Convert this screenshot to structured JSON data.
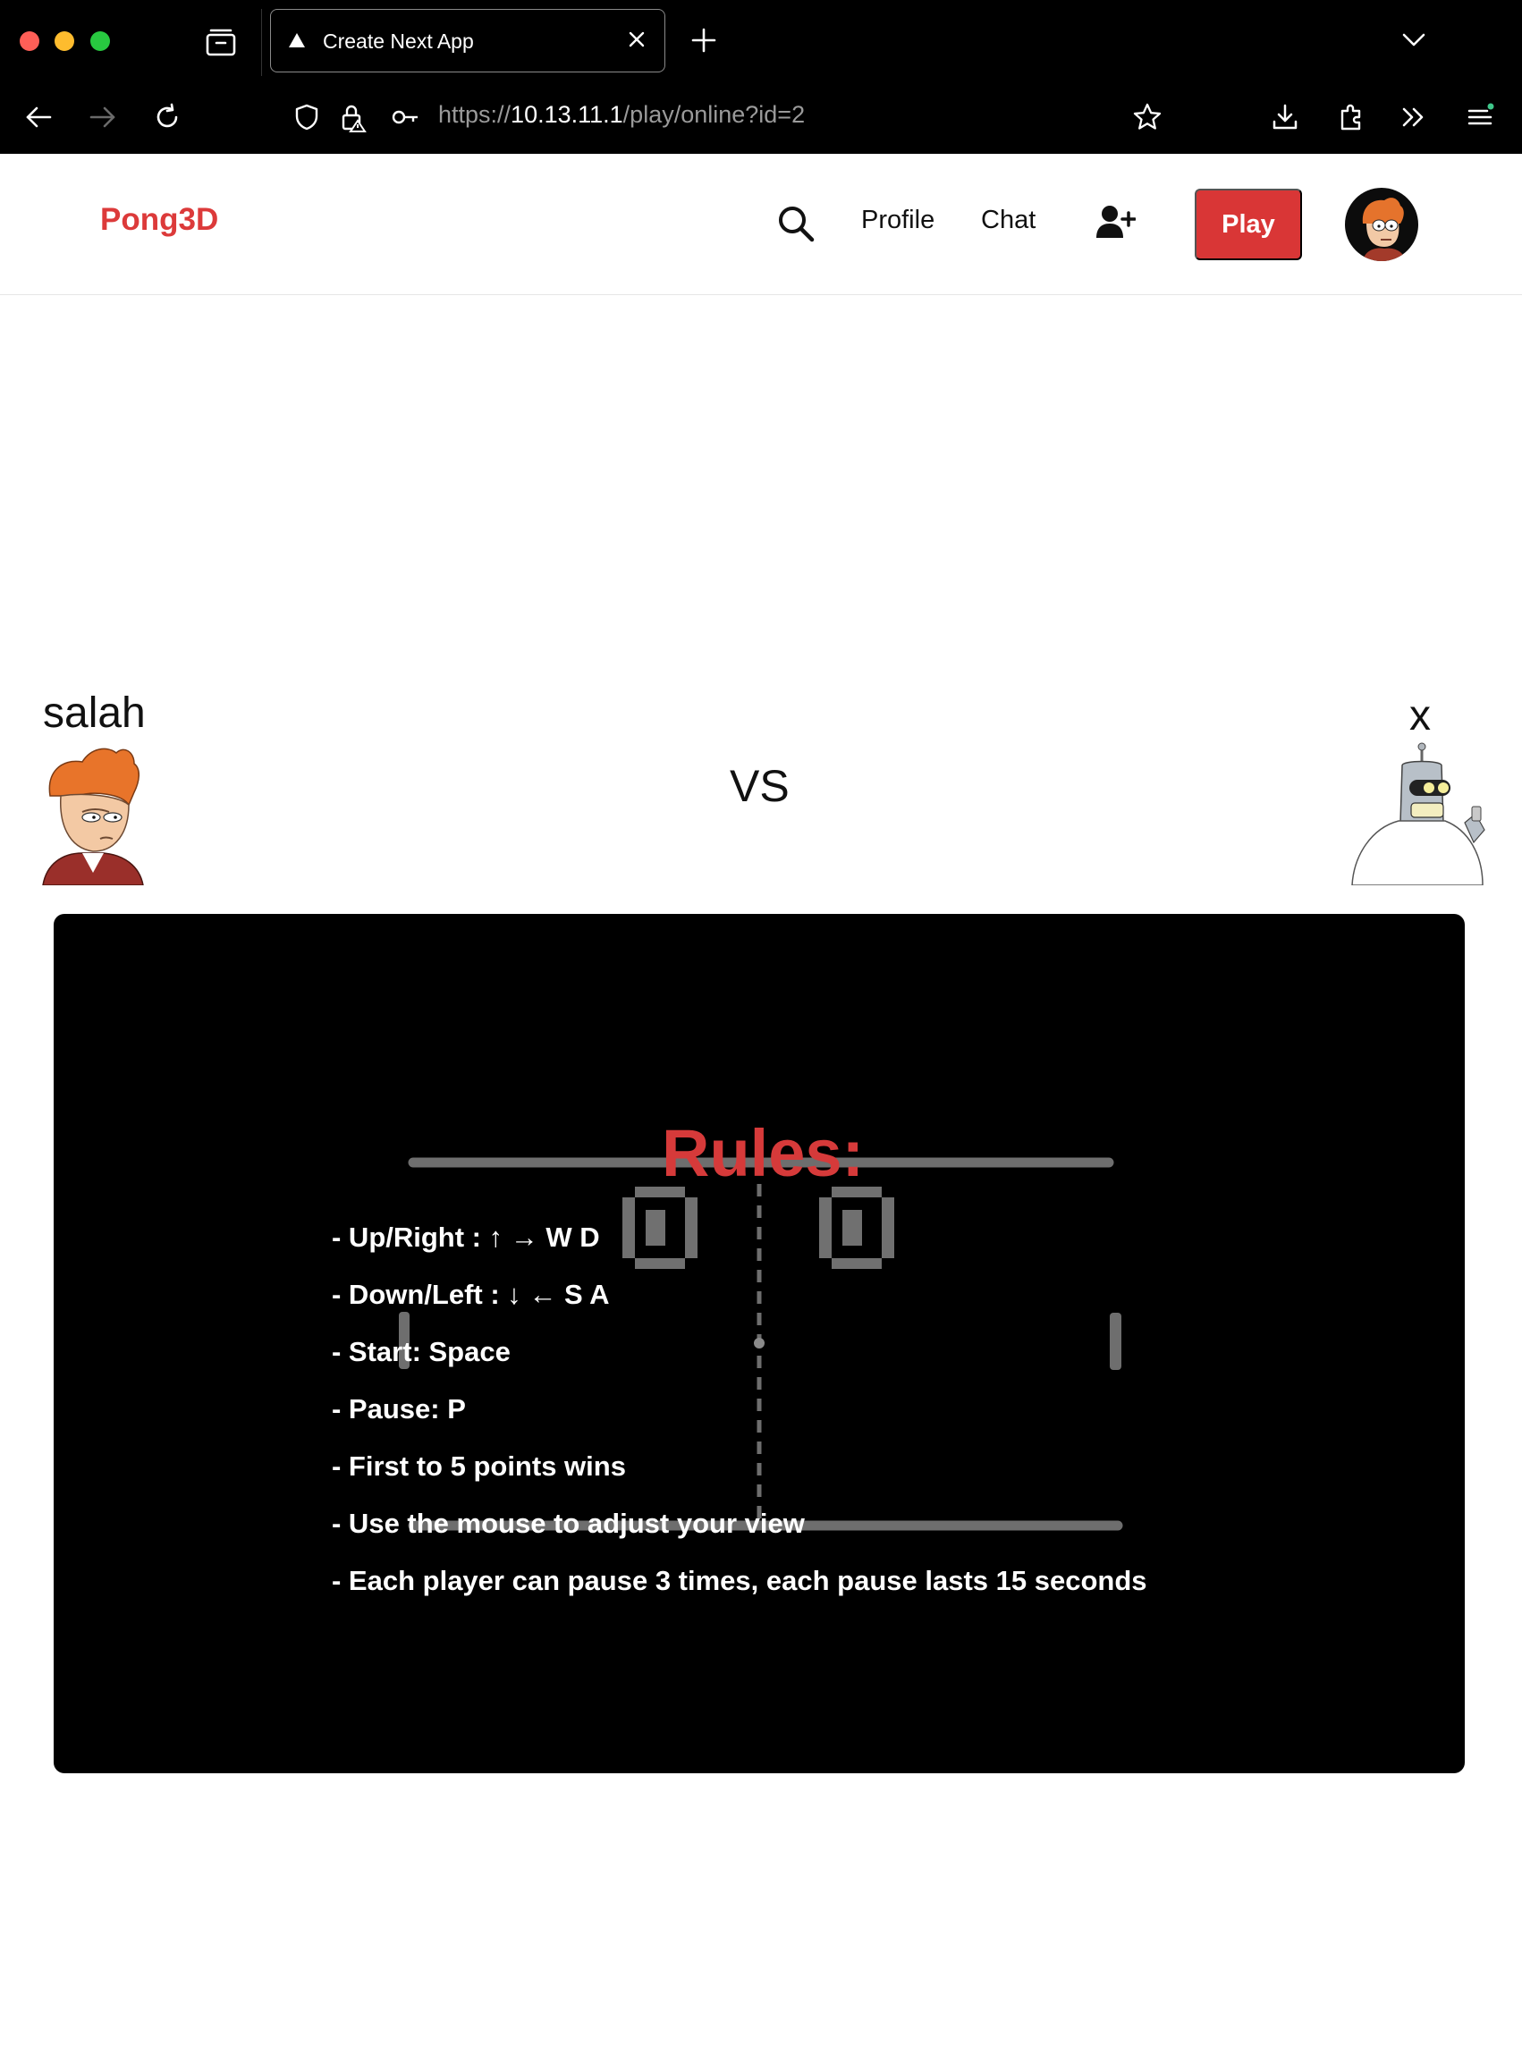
{
  "browser": {
    "tab_title": "Create Next App",
    "url_scheme": "https://",
    "url_host": "10.13.11.1",
    "url_path": "/play/online?id=2"
  },
  "header": {
    "logo": "Pong3D",
    "nav": {
      "profile": "Profile",
      "chat": "Chat"
    },
    "play_button": "Play",
    "icons": [
      "search-icon",
      "add-user-icon",
      "avatar"
    ]
  },
  "match": {
    "player_left": "salah",
    "player_right": "x",
    "vs": "VS"
  },
  "game": {
    "score_left": "0",
    "score_right": "0",
    "rules_title": "Rules:",
    "rules": [
      "- Up/Right : ↑ → W D",
      "- Down/Left : ↓ ← S A",
      "- Start: Space",
      "- Pause: P",
      "- First to 5 points wins",
      "- Use the mouse to adjust your view",
      "- Each player can pause 3 times, each pause lasts 15 seconds"
    ]
  },
  "colors": {
    "brand": "#dc3a3a",
    "play_button": "#d93636",
    "game_bg": "#000000",
    "field": "#6e6e6e"
  }
}
